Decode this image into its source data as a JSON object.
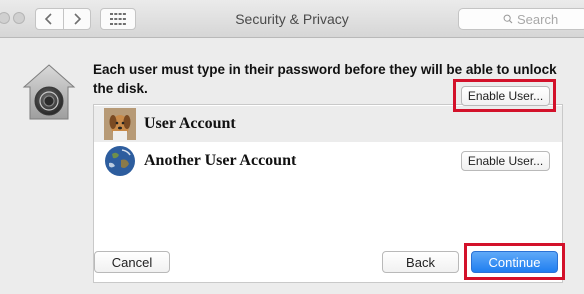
{
  "window": {
    "title": "Security & Privacy"
  },
  "toolbar": {
    "back_icon": "chevron-left-icon",
    "forward_icon": "chevron-right-icon",
    "grid_icon": "grid-icon",
    "search_placeholder": "Search"
  },
  "sheet": {
    "message": "Each user must type in their password before they will be able to unlock the disk.",
    "lock_icon": "filevault-lock-icon",
    "users": [
      {
        "name": "User Account",
        "avatar": "dog-avatar",
        "button_label": "Enable User...",
        "selected": true
      },
      {
        "name": "Another User Account",
        "avatar": "earth-avatar",
        "button_label": "Enable User...",
        "selected": false
      }
    ],
    "buttons": {
      "cancel": "Cancel",
      "back": "Back",
      "continue": "Continue"
    }
  },
  "colors": {
    "highlight": "#d3112a",
    "primary_button": "#1f7ef0"
  }
}
